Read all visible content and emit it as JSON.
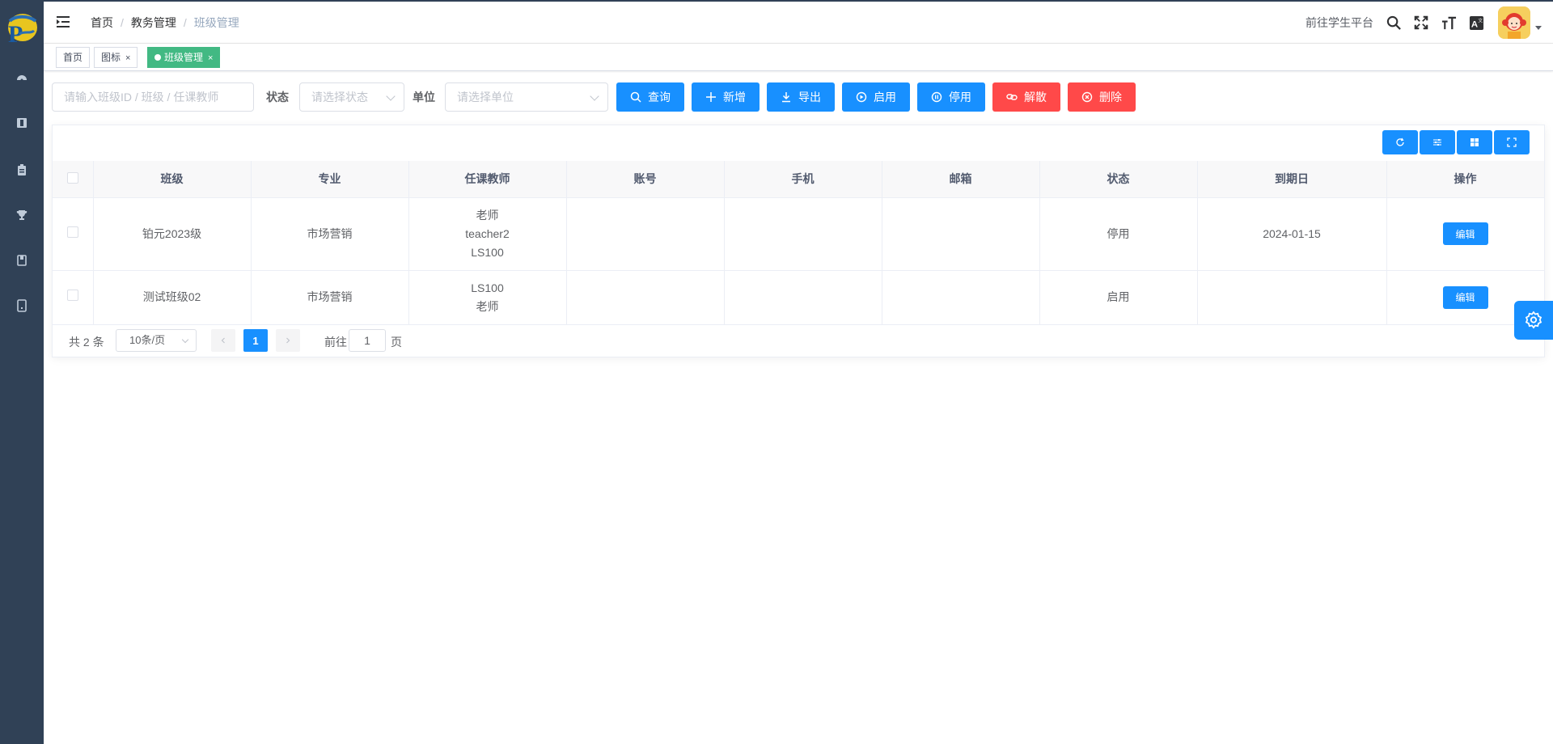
{
  "header": {
    "breadcrumb": [
      "首页",
      "教务管理",
      "班级管理"
    ],
    "goto_student": "前往学生平台"
  },
  "tags": [
    {
      "label": "首页",
      "closable": false
    },
    {
      "label": "图标",
      "closable": true
    },
    {
      "label": "班级管理",
      "closable": true,
      "active": true
    }
  ],
  "tag_close": "×",
  "filters": {
    "search_placeholder": "请输入班级ID / 班级 / 任课教师",
    "status_label": "状态",
    "status_placeholder": "请选择状态",
    "unit_label": "单位",
    "unit_placeholder": "请选择单位"
  },
  "buttons": {
    "query": "查询",
    "add": "新增",
    "export": "导出",
    "enable": "启用",
    "disable": "停用",
    "dissolve": "解散",
    "delete": "删除"
  },
  "table": {
    "columns": [
      "班级",
      "专业",
      "任课教师",
      "账号",
      "手机",
      "邮箱",
      "状态",
      "到期日",
      "操作"
    ],
    "rows": [
      {
        "class": "铂元2023级",
        "major": "市场营销",
        "teachers": [
          "老师",
          "teacher2",
          "LS100"
        ],
        "account": "",
        "phone": "",
        "email": "",
        "status": "停用",
        "expiry": "2024-01-15",
        "action": "编辑"
      },
      {
        "class": "测试班级02",
        "major": "市场营销",
        "teachers": [
          "LS100",
          "老师"
        ],
        "account": "",
        "phone": "",
        "email": "",
        "status": "启用",
        "expiry": "",
        "action": "编辑"
      }
    ]
  },
  "pagination": {
    "total_text": "共 2 条",
    "page_size": "10条/页",
    "current_page": "1",
    "goto_prefix": "前往",
    "goto_value": "1",
    "goto_suffix": "页"
  },
  "colors": {
    "sidebar": "#304156",
    "primary": "#1890ff",
    "danger": "#ff4949",
    "active_tag": "#42b983"
  }
}
